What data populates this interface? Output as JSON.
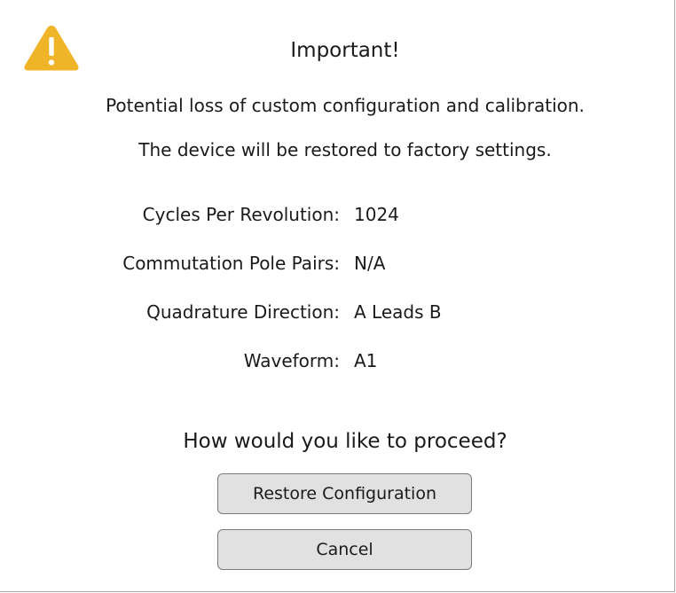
{
  "dialog": {
    "icon": "warning-triangle-icon",
    "title": "Important!",
    "message_line1": "Potential loss of custom configuration and calibration.",
    "message_line2": "The device will be restored to factory settings.",
    "details": [
      {
        "label": "Cycles Per Revolution:",
        "value": "1024"
      },
      {
        "label": "Commutation Pole Pairs:",
        "value": "N/A"
      },
      {
        "label": "Quadrature Direction:",
        "value": "A Leads B"
      },
      {
        "label": "Waveform:",
        "value": "A1"
      }
    ],
    "prompt": "How would you like to proceed?",
    "buttons": {
      "restore_label": "Restore Configuration",
      "cancel_label": "Cancel"
    }
  },
  "colors": {
    "warning": "#f0b429",
    "button_bg": "#e1e1e1",
    "button_border": "#7a7a7a"
  }
}
